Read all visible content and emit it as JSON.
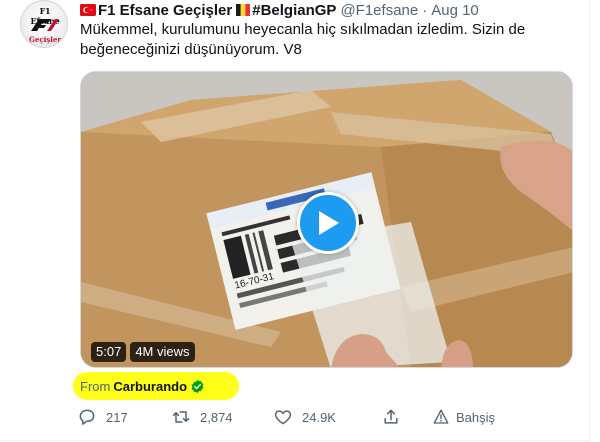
{
  "author": {
    "avatar_text_top": "F1 Efsane",
    "avatar_text_bottom": "Geçişler",
    "display_name": "F1 Efsane Geçişler",
    "hashtag": "#BelgianGP",
    "handle": "@F1efsane",
    "separator": "·",
    "date": "Aug 10"
  },
  "tweet": {
    "text_line1": "Mükemmel, kurulumunu heyecanla hiç sıkılmadan izledim. Sizin de",
    "text_line2": "beğeneceğinizi düşünüyorum.  V8"
  },
  "media": {
    "duration": "5:07",
    "views": "4M views",
    "label_code": "16-70-31"
  },
  "source": {
    "from_label": "From",
    "name": "Carburando"
  },
  "actions": {
    "replies": "217",
    "retweets": "2,874",
    "likes": "24.9K",
    "tip_label": "Bahşiş"
  },
  "colors": {
    "accent": "#1d9bf0",
    "muted": "#536471",
    "highlight": "#ffff00",
    "verified": "#00a300"
  },
  "icons": [
    "turkey-flag-icon",
    "belgium-flag-icon",
    "play-icon",
    "verified-icon",
    "reply-icon",
    "retweet-icon",
    "like-icon",
    "share-icon",
    "tip-icon"
  ]
}
